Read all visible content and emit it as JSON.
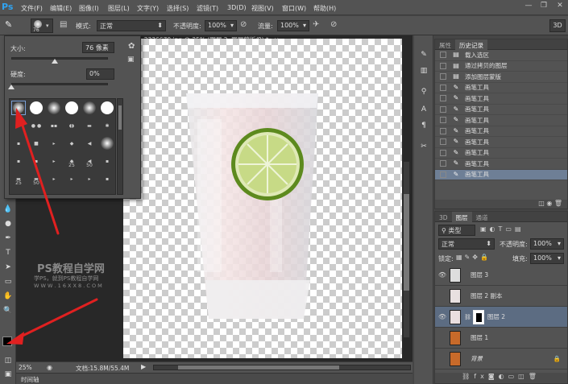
{
  "app": {
    "logo": "Ps"
  },
  "menu": {
    "items": [
      "文件(F)",
      "编辑(E)",
      "图像(I)",
      "图层(L)",
      "文字(Y)",
      "选择(S)",
      "滤镜(T)",
      "3D(D)",
      "视图(V)",
      "窗口(W)",
      "帮助(H)"
    ]
  },
  "options": {
    "brush_size": "76",
    "mode_label": "模式:",
    "mode_value": "正常",
    "opacity_label": "不透明度:",
    "opacity_value": "100%",
    "flow_label": "流量:",
    "flow_value": "100%",
    "threed_label": "3D"
  },
  "document": {
    "tab_title": "-2336670.jpg @ 25% (图层 2, 图层蒙版/8) *",
    "close": "×"
  },
  "brush_popup": {
    "size_label": "大小:",
    "size_value": "76 像素",
    "hardness_label": "硬度:",
    "hardness_value": "0%",
    "size_level": 0.45,
    "hardness_level": 0.0,
    "preset_numbers": [
      "25",
      "50",
      "25",
      "50"
    ]
  },
  "history": {
    "tabs": [
      "属性",
      "历史记录"
    ],
    "items": [
      "载入选区",
      "通过拷贝的图层",
      "添加图层蒙版",
      "画笔工具",
      "画笔工具",
      "画笔工具",
      "画笔工具",
      "画笔工具",
      "画笔工具",
      "画笔工具",
      "画笔工具",
      "画笔工具"
    ]
  },
  "layers": {
    "tabs": [
      "3D",
      "图层",
      "通道"
    ],
    "kind_label": "类型",
    "blend_mode": "正常",
    "opacity_label": "不透明度:",
    "opacity_value": "100%",
    "lock_label": "锁定:",
    "fill_label": "填充:",
    "fill_value": "100%",
    "items": [
      "图层 3",
      "图层 2 副本",
      "图层 2",
      "图层 1",
      "背景"
    ]
  },
  "status": {
    "zoom": "25%",
    "doc_size": "文档:15.8M/55.4M"
  },
  "timeline": {
    "label": "时间轴"
  },
  "watermark": {
    "line1": "PS教程自学网",
    "line2": "学PS，就到PS教程自学网",
    "line3": "W W W . 1 6 X X 8 . C O M"
  },
  "colors": {
    "accent": "#30a3f0",
    "arrow": "#e02020",
    "selection": "#6e7f96"
  }
}
